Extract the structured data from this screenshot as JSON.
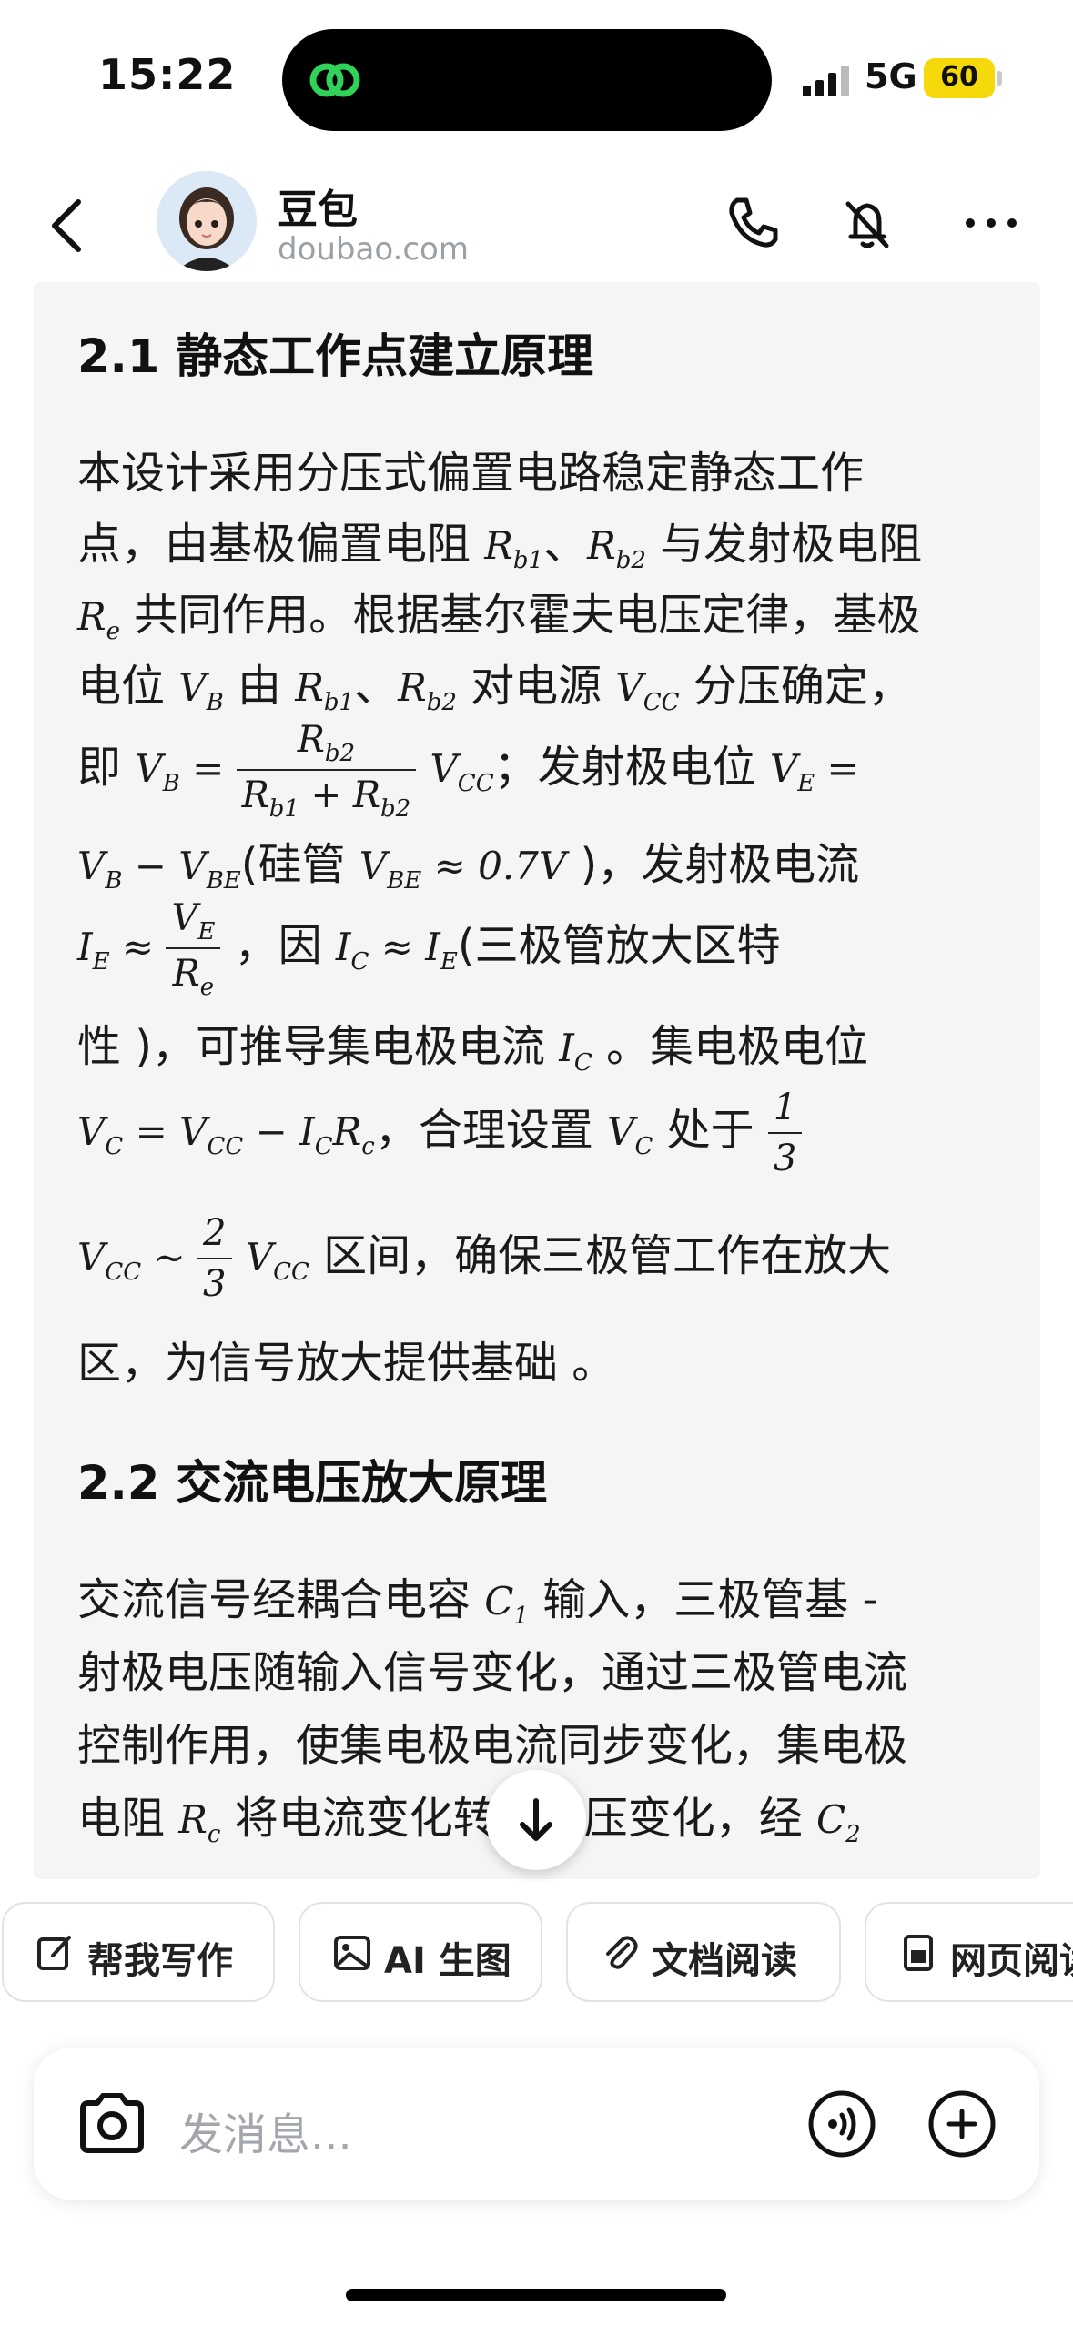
{
  "status": {
    "time": "15:22",
    "network": "5G",
    "battery": "60"
  },
  "header": {
    "name": "豆包",
    "domain": "doubao.com"
  },
  "content": {
    "h1": "2.1 静态工作点建立原理",
    "p1": {
      "l1": "本设计采用分压式偏置电路稳定静态工作",
      "l2a": "点，由基极偏置电阻 ",
      "l2b": "与发射极电阻",
      "l3b": " 共同作用。根据基尔霍夫电压定律，基极",
      "l4a": "电位 ",
      "l4b": " 由 ",
      "l4c": " 对电源 ",
      "l4d": " 分压确定，",
      "l5a": "即 ",
      "l5b": "；发射极电位 ",
      "l6a": "(硅管 ",
      "l6b": " )，发射极电流",
      "l7a": "，因 ",
      "l7b": "(三极管放大区特",
      "l8a": "性 )，可推导集电极电流 ",
      "l8b": " 。集电极电位",
      "l9a": "，合理设置 ",
      "l9b": " 处于 ",
      "l10a": " 区间，确保三极管工作在放大",
      "l11": "区，为信号放大提供基础 。"
    },
    "h2": "2.2 交流电压放大原理",
    "p2": {
      "l1a": "交流信号经耦合电容 ",
      "l1b": " 输入，三极管基 -",
      "l2": "射极电压随输入信号变化，通过三极管电流",
      "l3": "控制作用，使集电极电流同步变化，集电极",
      "l4a": "电阻 ",
      "l4b": " 将电流变化转",
      "l4c": "为电压变化，经 "
    }
  },
  "chips": [
    "帮我写作",
    "AI 生图",
    "文档阅读",
    "网页阅读"
  ],
  "input": {
    "placeholder": "发消息..."
  }
}
